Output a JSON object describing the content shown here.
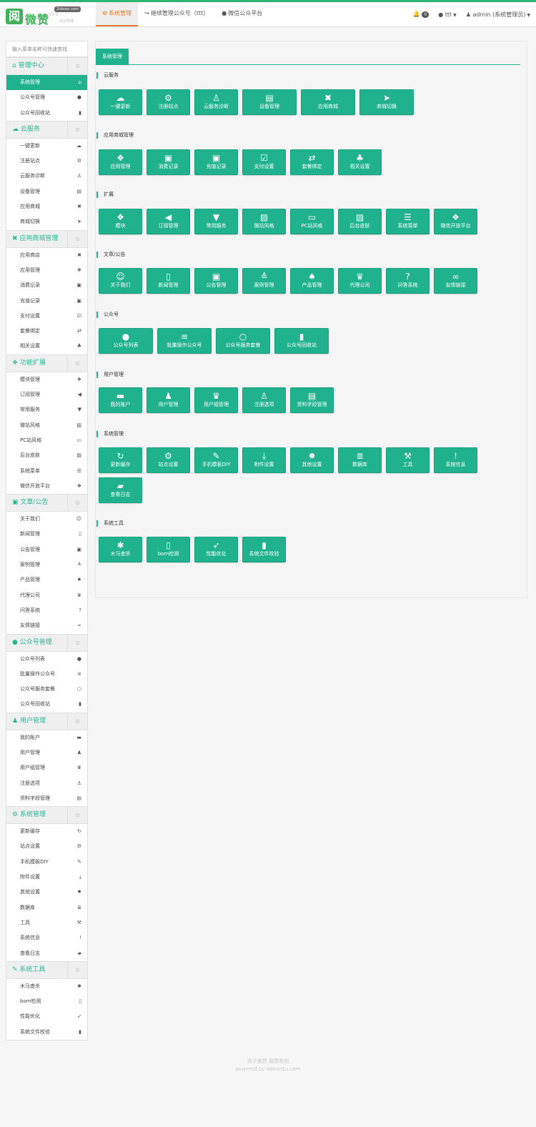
{
  "logo": {
    "mark": "阅",
    "name": "微赞",
    "version": "V2.0",
    "site": "2idsvsc.com",
    "tag": "后台管理"
  },
  "nav": {
    "tabs": [
      {
        "icon": "⚙",
        "label": "系统管理"
      },
      {
        "icon": "↪",
        "label": "继续管理公众号（ttt）"
      },
      {
        "icon": "●",
        "label": "微信公众平台"
      }
    ],
    "bell_count": "0",
    "account": "ttt",
    "user": "admin (系统管理员)"
  },
  "sidebar": {
    "search_placeholder": "输入菜单名称可快速查找",
    "groups": [
      {
        "icon": "⌂",
        "title": "管理中心",
        "items": [
          [
            "系统管理",
            "⌂"
          ],
          [
            "公众号管理",
            "●"
          ],
          [
            "公众号回收站",
            "▮"
          ]
        ]
      },
      {
        "icon": "☁",
        "title": "云服务",
        "items": [
          [
            "一键更新",
            "☁"
          ],
          [
            "注册站点",
            "⚙"
          ],
          [
            "云服务诊断",
            "♙"
          ],
          [
            "设备管理",
            "▤"
          ],
          [
            "应用商城",
            "✖"
          ],
          [
            "商城切换",
            "➤"
          ]
        ]
      },
      {
        "icon": "✖",
        "title": "应用商城管理",
        "items": [
          [
            "应用商店",
            "✖"
          ],
          [
            "应用管理",
            "❖"
          ],
          [
            "消费记录",
            "▣"
          ],
          [
            "充值记录",
            "▣"
          ],
          [
            "支付设置",
            "☑"
          ],
          [
            "套餐绑定",
            "⇄"
          ],
          [
            "相关设置",
            "♣"
          ]
        ]
      },
      {
        "icon": "❖",
        "title": "功能扩展",
        "items": [
          [
            "模块管理",
            "❖"
          ],
          [
            "订阅管理",
            "◀"
          ],
          [
            "常用服务",
            "▼"
          ],
          [
            "微站风格",
            "▨"
          ],
          [
            "PC站风格",
            "▭"
          ],
          [
            "后台皮肤",
            "▨"
          ],
          [
            "系统菜单",
            "☰"
          ],
          [
            "微信开放平台",
            "❖"
          ]
        ]
      },
      {
        "icon": "▣",
        "title": "文章/公告",
        "items": [
          [
            "关于我们",
            "☺"
          ],
          [
            "新闻管理",
            "▯"
          ],
          [
            "公告管理",
            "▣"
          ],
          [
            "案例管理",
            "≙"
          ],
          [
            "产品管理",
            "♠"
          ],
          [
            "代理公司",
            "♛"
          ],
          [
            "问答系统",
            "?"
          ],
          [
            "友情链接",
            "∞"
          ]
        ]
      },
      {
        "icon": "●",
        "title": "公众号管理",
        "items": [
          [
            "公众号列表",
            "●"
          ],
          [
            "批量操作公众号",
            "≡"
          ],
          [
            "公众号服务套餐",
            "○"
          ],
          [
            "公众号回收站",
            "▮"
          ]
        ]
      },
      {
        "icon": "♟",
        "title": "用户管理",
        "items": [
          [
            "我的账户",
            "▬"
          ],
          [
            "用户管理",
            "♟"
          ],
          [
            "用户组管理",
            "♛"
          ],
          [
            "注册选项",
            "♙"
          ],
          [
            "资料字段管理",
            "▤"
          ]
        ]
      },
      {
        "icon": "⚙",
        "title": "系统管理",
        "items": [
          [
            "更新缓存",
            "↻"
          ],
          [
            "站点设置",
            "⚙"
          ],
          [
            "手机模板DIY",
            "✎"
          ],
          [
            "附件设置",
            "⤓"
          ],
          [
            "其他设置",
            "✹"
          ],
          [
            "数据库",
            "≣"
          ],
          [
            "工具",
            "⚒"
          ],
          [
            "系统信息",
            "!"
          ],
          [
            "查看日志",
            "▰"
          ]
        ]
      },
      {
        "icon": "✎",
        "title": "系统工具",
        "items": [
          [
            "木马查杀",
            "✱"
          ],
          [
            "bom检测",
            "▯"
          ],
          [
            "性能优化",
            "➶"
          ],
          [
            "系统文件校验",
            "▮"
          ]
        ]
      }
    ]
  },
  "main": {
    "breadcrumb": "系统管理",
    "sections": [
      {
        "title": "云服务",
        "tiles": [
          [
            "☁",
            "一键更新"
          ],
          [
            "⚙",
            "注册站点"
          ],
          [
            "♙",
            "云服务诊断"
          ],
          [
            "▤",
            "设备管理"
          ],
          [
            "✖",
            "应用商城"
          ],
          [
            "➤",
            "商城切换"
          ]
        ]
      },
      {
        "title": "应用商城管理",
        "tiles": [
          [
            "❖",
            "应用管理"
          ],
          [
            "▣",
            "消费记录"
          ],
          [
            "▣",
            "充值记录"
          ],
          [
            "☑",
            "支付设置"
          ],
          [
            "⇄",
            "套餐绑定"
          ],
          [
            "♣",
            "相关设置"
          ]
        ]
      },
      {
        "title": "扩展",
        "tiles": [
          [
            "❖",
            "模块"
          ],
          [
            "◀",
            "订阅管理"
          ],
          [
            "▼",
            "常用服务"
          ],
          [
            "▨",
            "微站风格"
          ],
          [
            "▭",
            "PC站风格"
          ],
          [
            "▨",
            "后台皮肤"
          ],
          [
            "☰",
            "系统菜单"
          ],
          [
            "❖",
            "微信开放平台"
          ]
        ]
      },
      {
        "title": "文章/公告",
        "tiles": [
          [
            "☺",
            "关于我们"
          ],
          [
            "▯",
            "新闻管理"
          ],
          [
            "▣",
            "公告管理"
          ],
          [
            "≙",
            "案例管理"
          ],
          [
            "♠",
            "产品管理"
          ],
          [
            "♛",
            "代理公司"
          ],
          [
            "?",
            "问答系统"
          ],
          [
            "∞",
            "友情链接"
          ]
        ]
      },
      {
        "title": "公众号",
        "tiles": [
          [
            "●",
            "公众号列表"
          ],
          [
            "≡",
            "批量操作公众号"
          ],
          [
            "○",
            "公众号服务套餐"
          ],
          [
            "▮",
            "公众号回收站"
          ]
        ]
      },
      {
        "title": "用户管理",
        "tiles": [
          [
            "▬",
            "我的账户"
          ],
          [
            "♟",
            "用户管理"
          ],
          [
            "♛",
            "用户组管理"
          ],
          [
            "♙",
            "注册选项"
          ],
          [
            "▤",
            "资料字段管理"
          ]
        ]
      },
      {
        "title": "系统管理",
        "tiles": [
          [
            "↻",
            "更新缓存"
          ],
          [
            "⚙",
            "站点设置"
          ],
          [
            "✎",
            "手机模板DIY"
          ],
          [
            "⤓",
            "附件设置"
          ],
          [
            "✹",
            "其他设置"
          ],
          [
            "≣",
            "数据库"
          ],
          [
            "⚒",
            "工具"
          ],
          [
            "!",
            "系统信息"
          ],
          [
            "▰",
            "查看日志"
          ]
        ]
      },
      {
        "title": "系统工具",
        "tiles": [
          [
            "✱",
            "木马查杀"
          ],
          [
            "▯",
            "bom检测"
          ],
          [
            "➶",
            "性能优化"
          ],
          [
            "▮",
            "系统文件校验"
          ]
        ]
      }
    ]
  },
  "footer": {
    "line1": "关于微赞   微赞帮助",
    "line2": "powered by admin5u.com"
  },
  "colors": {
    "accent": "#20b28d",
    "active_tab": "#e07a2e",
    "top_line": "#2bb672"
  }
}
